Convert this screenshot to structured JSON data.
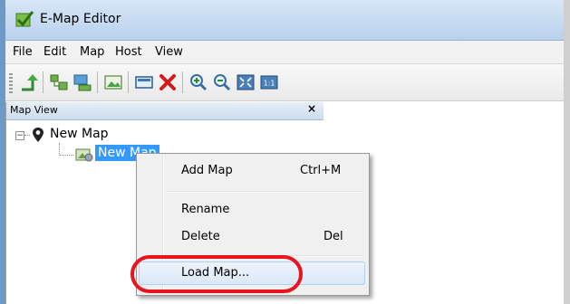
{
  "window": {
    "title": "E-Map Editor",
    "app_icon": "emap-editor-icon"
  },
  "menubar": {
    "items": [
      "File",
      "Edit",
      "Map",
      "Host",
      "View"
    ]
  },
  "toolbar": {
    "buttons": [
      "up-level-icon",
      "add-host-icon",
      "add-device-icon",
      "set-background-icon",
      "properties-icon",
      "delete-icon",
      "zoom-in-icon",
      "zoom-out-icon",
      "fit-window-icon",
      "actual-size-icon"
    ],
    "actual_size_label": "1:1"
  },
  "map_view": {
    "title": "Map View",
    "close_glyph": "×",
    "tree": {
      "root_label": "New Map",
      "child_label": "New Map"
    }
  },
  "context_menu": {
    "items": [
      {
        "label": "Add Map",
        "shortcut": "Ctrl+M"
      },
      {
        "label": "Rename",
        "shortcut": ""
      },
      {
        "label": "Delete",
        "shortcut": "Del"
      },
      {
        "label": "Load Map...",
        "shortcut": ""
      }
    ],
    "hovered_item": "Load Map..."
  },
  "colors": {
    "selection": "#3399ff",
    "highlight_ring": "#e8141e",
    "delete_icon": "#d41a1a"
  }
}
